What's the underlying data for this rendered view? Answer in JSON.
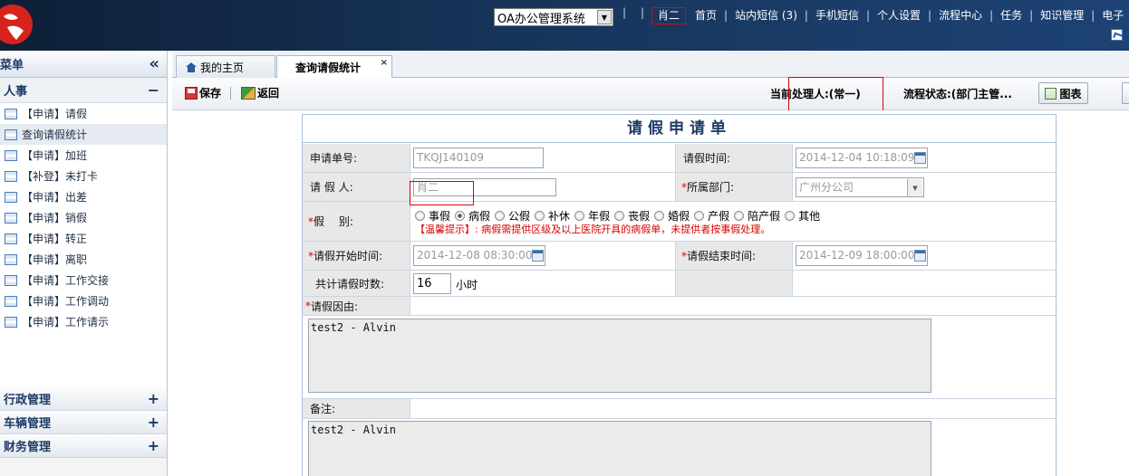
{
  "header": {
    "system_select": "OA办公管理系统",
    "username": "肖二",
    "nav": [
      "首页",
      "站内短信 (3)",
      "手机短信",
      "个人设置",
      "流程中心",
      "任务",
      "知识管理",
      "电子"
    ]
  },
  "sidebar": {
    "title": "菜单",
    "collapse_icon": "double-chevron-left",
    "active_group": "人事",
    "items": [
      "【申请】请假",
      "查询请假统计",
      "【申请】加班",
      "【补登】未打卡",
      "【申请】出差",
      "【申请】销假",
      "【申请】转正",
      "【申请】离职",
      "【申请】工作交接",
      "【申请】工作调动",
      "【申请】工作请示"
    ],
    "other_groups": [
      "行政管理",
      "车辆管理",
      "财务管理"
    ]
  },
  "tabs": {
    "home": "我的主页",
    "active": "查询请假统计",
    "close": "×"
  },
  "toolbar": {
    "save": "保存",
    "back": "返回",
    "handler": "当前处理人:(常一)",
    "status": "流程状态:(部门主管...",
    "chart": "图表"
  },
  "form": {
    "title": "请假申请单",
    "app_no_label": "申请单号:",
    "app_no_value": "TKQJ140109",
    "leave_time_label": "请假时间:",
    "leave_time_value": "2014-12-04 10:18:09",
    "applicant_label": "请 假 人:",
    "applicant_value": "肖二",
    "dept_label": "所属部门:",
    "dept_value": "广州分公司",
    "type_label": "假　 别:",
    "types": [
      "事假",
      "病假",
      "公假",
      "补休",
      "年假",
      "丧假",
      "婚假",
      "产假",
      "陪产假",
      "其他"
    ],
    "checked_type": "病假",
    "tip": "【温馨提示】: 病假需提供区级及以上医院开具的病假单，未提供者按事假处理。",
    "start_label": "请假开始时间:",
    "start_value": "2014-12-08 08:30:00",
    "end_label": "请假结束时间:",
    "end_value": "2014-12-09 18:00:00",
    "hours_label": "共计请假时数:",
    "hours_value": "16",
    "hours_unit": "小时",
    "reason_label": "请假因由:",
    "reason_value": "test2 - Alvin",
    "remark_label": "备注:",
    "remark_value": "test2 - Alvin",
    "required_mark": "*"
  }
}
